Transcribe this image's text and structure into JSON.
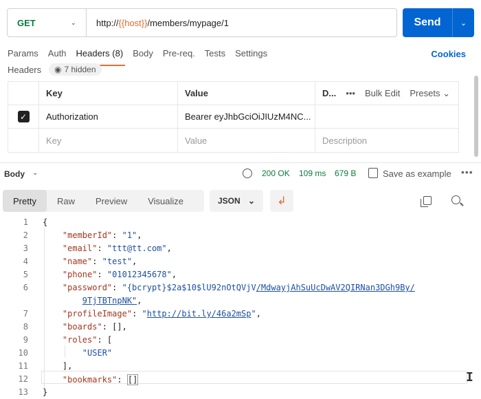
{
  "request": {
    "method": "GET",
    "url_prefix": "http://",
    "url_var": "{{host}}",
    "url_suffix": "/members/mypage/1",
    "send_label": "Send"
  },
  "tabs": [
    {
      "label": "Params"
    },
    {
      "label": "Auth"
    },
    {
      "label": "Headers (8)",
      "active": true
    },
    {
      "label": "Body"
    },
    {
      "label": "Pre-req."
    },
    {
      "label": "Tests"
    },
    {
      "label": "Settings"
    }
  ],
  "cookies_label": "Cookies",
  "headers_section": {
    "title": "Headers",
    "hidden_label": "7 hidden",
    "columns": {
      "key": "Key",
      "value": "Value",
      "desc": "D...",
      "bulk_edit": "Bulk Edit",
      "presets": "Presets"
    },
    "rows": [
      {
        "key": "Authorization",
        "value": "Bearer eyJhbGciOiJIUzM4NC..."
      }
    ],
    "placeholders": {
      "key": "Key",
      "value": "Value",
      "desc": "Description"
    }
  },
  "response": {
    "body_label": "Body",
    "status": "200 OK",
    "time": "109 ms",
    "size": "679 B",
    "save_label": "Save as example",
    "view_tabs": [
      "Pretty",
      "Raw",
      "Preview",
      "Visualize"
    ],
    "format": "JSON"
  },
  "code_lines": {
    "n": [
      "1",
      "2",
      "3",
      "4",
      "5",
      "6",
      "7",
      "8",
      "9",
      "10",
      "11",
      "12",
      "13"
    ],
    "memberId_val": "\"1\"",
    "email_val": "\"ttt@tt.com\"",
    "name_val": "\"test\"",
    "phone_val": "\"01012345678\"",
    "password_val_a": "\"{bcrypt}$2a$10$lU92nOtQVjV",
    "password_val_b": "/MdwayjAhSuUcDwAV2QIRNan3DGh9By/",
    "password_val_c": "9TjTBTnpNK\"",
    "profileImage_val": "http://bit.ly/46a2mSp",
    "role_val": "\"USER\""
  }
}
